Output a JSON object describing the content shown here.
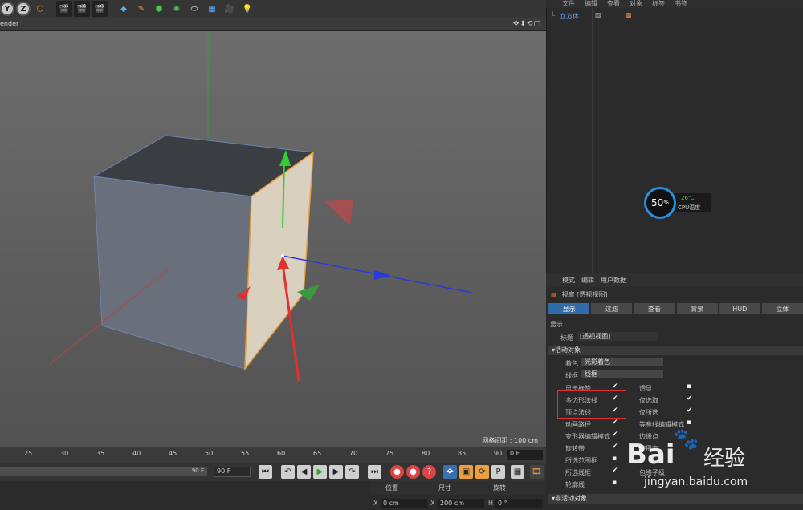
{
  "toolbar": {
    "axis_y": "Y",
    "axis_z": "Z"
  },
  "viewport": {
    "menu_tail": "ender",
    "nav_icons": "✥⬍⟲▢",
    "grid_spacing": "网格间距 : 100 cm"
  },
  "timeline": {
    "ticks": [
      "25",
      "30",
      "35",
      "40",
      "45",
      "50",
      "55",
      "60",
      "65",
      "70",
      "75",
      "80",
      "85",
      "90"
    ],
    "current_frame": "0 F",
    "end_frame": "90 F",
    "end_frame_field": "90 F"
  },
  "coords": {
    "pos_label": "位置",
    "size_label": "尺寸",
    "rot_label": "旋转",
    "x_label": "X",
    "x_val": "0 cm",
    "sx_label": "X",
    "sx_val": "200 cm",
    "h_label": "H",
    "h_val": "0 °"
  },
  "object_manager": {
    "menu": [
      "文件",
      "编辑",
      "查看",
      "对象",
      "标签",
      "书签"
    ],
    "cube": "立方体"
  },
  "cpu": {
    "percent": "50",
    "unit": "%",
    "temp": "26℃",
    "label": "CPU温度"
  },
  "attributes": {
    "menu": [
      "模式",
      "编辑",
      "用户数据"
    ],
    "title": "视窗 [透视视图]",
    "tabs": [
      "显示",
      "过滤",
      "查看",
      "背景",
      "HUD",
      "立体"
    ],
    "section_display": "显示",
    "name_label": "标题",
    "name_value": "[透视视图]",
    "section_active": "▾活动对象",
    "shading_label": "着色",
    "shading_value": "光影着色",
    "wire_label": "线框",
    "wire_value": "线框",
    "left_opts": [
      "显示标签",
      "多边形法线",
      "顶点法线",
      "动画路径",
      "变形器编辑模式",
      "旋转带",
      "所选范围框",
      "所选线框",
      "轮廓线"
    ],
    "right_opts": [
      "透显",
      "仅选取",
      "仅所选",
      "等参线编辑模式",
      "边缘点",
      "使用亮",
      "包络子级"
    ],
    "section_inactive": "▾非活动对象"
  },
  "watermark": {
    "brand": "Bai",
    "brand2": "经验",
    "url": "jingyan.baidu.com"
  }
}
